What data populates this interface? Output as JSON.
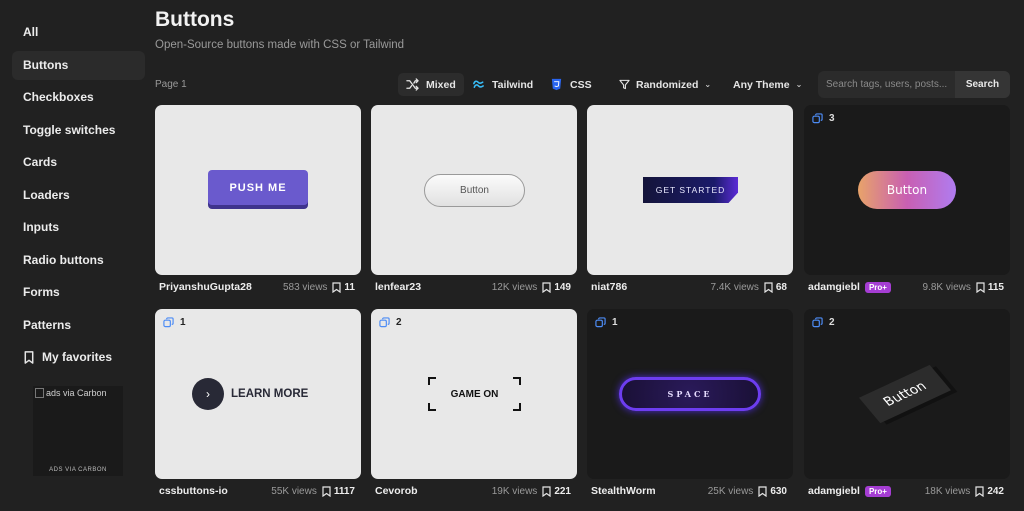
{
  "sidebar": {
    "items": [
      {
        "label": "All"
      },
      {
        "label": "Buttons",
        "active": true
      },
      {
        "label": "Checkboxes"
      },
      {
        "label": "Toggle switches"
      },
      {
        "label": "Cards"
      },
      {
        "label": "Loaders"
      },
      {
        "label": "Inputs"
      },
      {
        "label": "Radio buttons"
      },
      {
        "label": "Forms"
      },
      {
        "label": "Patterns"
      }
    ],
    "favorites_label": "My favorites",
    "ad": {
      "alt_text": "ads via Carbon",
      "footer": "ADS VIA CARBON"
    }
  },
  "header": {
    "title": "Buttons",
    "subtitle": "Open-Source buttons made with CSS or Tailwind"
  },
  "toolbar": {
    "page_label": "Page 1",
    "mixed_label": "Mixed",
    "tailwind_label": "Tailwind",
    "css_label": "CSS",
    "sort_label": "Randomized",
    "theme_label": "Any Theme",
    "search_placeholder": "Search tags, users, posts...",
    "search_button": "Search"
  },
  "colors": {
    "background": "#212121",
    "pro_badge": "#a53dd3",
    "accent_blue": "#4d8cf5"
  },
  "cards": [
    {
      "author": "PriyanshuGupta28",
      "views": "583 views",
      "saves": "11",
      "demo_label": "PUSH ME",
      "theme": "light"
    },
    {
      "author": "lenfear23",
      "views": "12K views",
      "saves": "149",
      "demo_label": "Button",
      "theme": "light"
    },
    {
      "author": "niat786",
      "views": "7.4K views",
      "saves": "68",
      "demo_label": "GET STARTED",
      "theme": "light"
    },
    {
      "author": "adamgiebl",
      "pro": "Pro+",
      "views": "9.8K views",
      "saves": "115",
      "variants": "3",
      "demo_label": "Button",
      "theme": "dark"
    },
    {
      "author": "cssbuttons-io",
      "views": "55K views",
      "saves": "1117",
      "variants": "1",
      "demo_label": "LEARN MORE",
      "theme": "light"
    },
    {
      "author": "Cevorob",
      "views": "19K views",
      "saves": "221",
      "variants": "2",
      "demo_label": "GAME ON",
      "theme": "light"
    },
    {
      "author": "StealthWorm",
      "views": "25K views",
      "saves": "630",
      "variants": "1",
      "demo_label": "SPACE",
      "theme": "dark"
    },
    {
      "author": "adamgiebl",
      "pro": "Pro+",
      "views": "18K views",
      "saves": "242",
      "variants": "2",
      "demo_label": "Button",
      "theme": "dark"
    }
  ]
}
